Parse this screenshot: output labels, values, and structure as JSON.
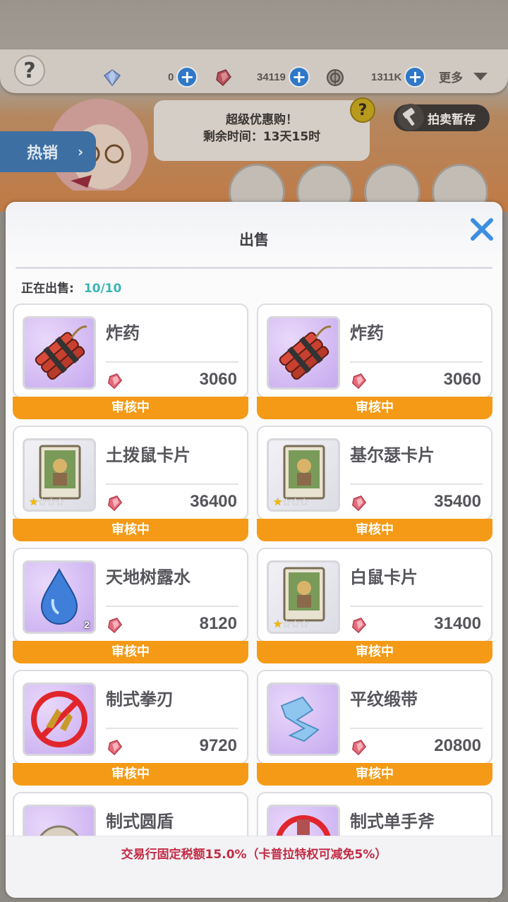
{
  "resources": {
    "diamond": {
      "value": "0",
      "icon": "diamond-icon"
    },
    "gem": {
      "value": "34119",
      "icon": "red-gem-icon"
    },
    "coin": {
      "value": "1311K",
      "icon": "coin-icon"
    },
    "more_label": "更多"
  },
  "help_label": "?",
  "hot_tab": {
    "label": "热销",
    "chevron": "›"
  },
  "promo": {
    "line1": "超级优惠购！",
    "line2": "剩余时间：13天15时",
    "help": "?"
  },
  "auction_storage": "拍卖暂存",
  "modal": {
    "title": "出售",
    "selling_label": "正在出售:",
    "selling_count": "10/10",
    "fee_notice": "交易行固定税额15.0%（卡普拉特权可减免5%）"
  },
  "colors": {
    "accent_orange": "#f49a16",
    "teal": "#3bb4b4",
    "fee_red": "#c22b44",
    "close_blue": "#3c8fe0"
  },
  "items": [
    {
      "name": "炸药",
      "price": "3060",
      "status": "审核中",
      "icon": "dynamite-icon",
      "qty": "",
      "stars": 0
    },
    {
      "name": "炸药",
      "price": "3060",
      "status": "审核中",
      "icon": "dynamite-icon",
      "qty": "",
      "stars": 0
    },
    {
      "name": "土拨鼠卡片",
      "price": "36400",
      "status": "审核中",
      "icon": "card-icon",
      "qty": "",
      "stars": 1
    },
    {
      "name": "基尔瑟卡片",
      "price": "35400",
      "status": "审核中",
      "icon": "card-icon",
      "qty": "",
      "stars": 1
    },
    {
      "name": "天地树露水",
      "price": "8120",
      "status": "审核中",
      "icon": "water-drop-icon",
      "qty": "2",
      "stars": 0
    },
    {
      "name": "白鼠卡片",
      "price": "31400",
      "status": "审核中",
      "icon": "card-icon",
      "qty": "",
      "stars": 1
    },
    {
      "name": "制式拳刃",
      "price": "9720",
      "status": "审核中",
      "icon": "knuckle-blade-icon",
      "qty": "",
      "stars": 0
    },
    {
      "name": "平纹缎带",
      "price": "20800",
      "status": "审核中",
      "icon": "ribbon-icon",
      "qty": "",
      "stars": 0
    },
    {
      "name": "制式圆盾",
      "price": "",
      "status": "",
      "icon": "round-shield-icon",
      "qty": "",
      "stars": 0
    },
    {
      "name": "制式单手斧",
      "price": "",
      "status": "",
      "icon": "hand-axe-icon",
      "qty": "",
      "stars": 0
    }
  ]
}
